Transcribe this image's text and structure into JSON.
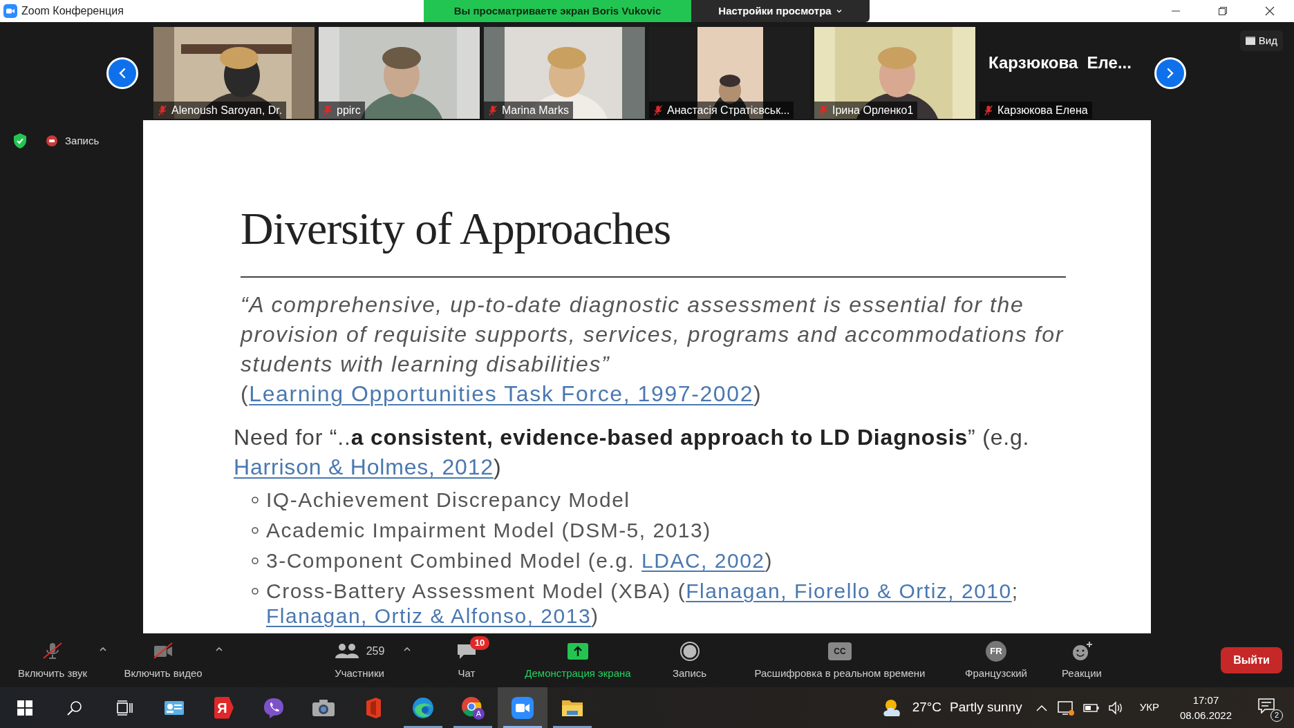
{
  "window": {
    "title": "Zoom Конференция",
    "viewing_banner": "Вы просматриваете экран Boris Vukovic",
    "view_options": "Настройки просмотра"
  },
  "view_button": "Вид",
  "gallery": [
    {
      "kind": "video",
      "name": "Alenoush Saroyan, Dr.",
      "muted": true
    },
    {
      "kind": "video",
      "name": "ppirc",
      "muted": true
    },
    {
      "kind": "video",
      "name": "Marina Marks",
      "muted": true
    },
    {
      "kind": "video",
      "name": "Анастасія Стратієвськ...",
      "muted": true
    },
    {
      "kind": "video",
      "name": "Ірина Орленко1",
      "muted": true
    },
    {
      "kind": "name_only",
      "display_name": "Карзюкова  Еле...",
      "name": "Карзюкова Елена",
      "muted": true
    }
  ],
  "recording_indicator": "Запись",
  "slide": {
    "title": "Diversity of Approaches",
    "paragraphs": [
      {
        "kind": "quote",
        "segments": [
          {
            "kind": "text",
            "text": "*“A comprehensive, up-to-date diagnostic assessment is essential for the provision of requisite supports, services, programs and accommodations for students with learning disabilities”* ("
          },
          {
            "kind": "link",
            "text": "Learning Opportunities Task Force, 1997-2002"
          },
          {
            "kind": "text",
            "text": ")"
          }
        ]
      },
      {
        "kind": "lead",
        "segments": [
          {
            "kind": "text",
            "text": "Need for “..**a consistent, evidence-based approach to LD Diagnosis**” (e.g. "
          },
          {
            "kind": "link",
            "text": "Harrison & Holmes, 2012"
          },
          {
            "kind": "text",
            "text": ")"
          }
        ]
      }
    ],
    "bullets": [
      {
        "segments": [
          {
            "kind": "text",
            "text": "IQ-Achievement Discrepancy Model"
          }
        ]
      },
      {
        "segments": [
          {
            "kind": "text",
            "text": "Academic Impairment Model (DSM-5, 2013)"
          }
        ]
      },
      {
        "segments": [
          {
            "kind": "text",
            "text": "3-Component Combined Model (e.g. "
          },
          {
            "kind": "link",
            "text": "LDAC, 2002"
          },
          {
            "kind": "text",
            "text": ")"
          }
        ]
      },
      {
        "segments": [
          {
            "kind": "text",
            "text": "Cross-Battery Assessment Model (XBA) ("
          },
          {
            "kind": "link",
            "text": "Flanagan, Fiorello & Ortiz, 2010"
          },
          {
            "kind": "text",
            "text": "; "
          },
          {
            "kind": "link",
            "text": "Flanagan, Ortiz & Alfonso, 2013"
          },
          {
            "kind": "text",
            "text": ")"
          }
        ]
      }
    ]
  },
  "toolbar": [
    {
      "kind": "mic",
      "label": "Включить звук",
      "off": true,
      "menu": true
    },
    {
      "kind": "video",
      "label": "Включить видео",
      "off": true,
      "menu": true
    },
    {
      "kind": "participants",
      "label": "Участники",
      "count": "259",
      "menu": true
    },
    {
      "kind": "chat",
      "label": "Чат",
      "badge": "10"
    },
    {
      "kind": "share",
      "label": "Демонстрация экрана"
    },
    {
      "kind": "record",
      "label": "Запись"
    },
    {
      "kind": "captions",
      "label": "Расшифровка в реальном времени",
      "icon_text": "CC"
    },
    {
      "kind": "language",
      "label": "Французский",
      "icon_text": "FR"
    },
    {
      "kind": "reactions",
      "label": "Реакции"
    }
  ],
  "leave_button": "Выйти",
  "taskbar": {
    "apps": [
      {
        "kind": "start",
        "running": false,
        "selected": false
      },
      {
        "kind": "search",
        "running": false,
        "selected": false
      },
      {
        "kind": "task_view",
        "running": false,
        "selected": false
      },
      {
        "kind": "card",
        "running": false,
        "selected": false
      },
      {
        "kind": "yandex",
        "glyph": "Я",
        "running": false,
        "selected": false
      },
      {
        "kind": "viber",
        "running": false,
        "selected": false
      },
      {
        "kind": "camera",
        "running": false,
        "selected": false
      },
      {
        "kind": "office",
        "running": false,
        "selected": false
      },
      {
        "kind": "edge",
        "running": true,
        "selected": false
      },
      {
        "kind": "chrome",
        "badge": "A",
        "running": true,
        "selected": false
      },
      {
        "kind": "zoom",
        "running": true,
        "selected": true
      },
      {
        "kind": "explorer",
        "running": true,
        "selected": false
      }
    ],
    "weather": {
      "temperature": "27°C",
      "condition": "Partly sunny"
    },
    "language": "УКР",
    "time": "17:07",
    "date": "08.06.2022",
    "notifications": "2"
  }
}
